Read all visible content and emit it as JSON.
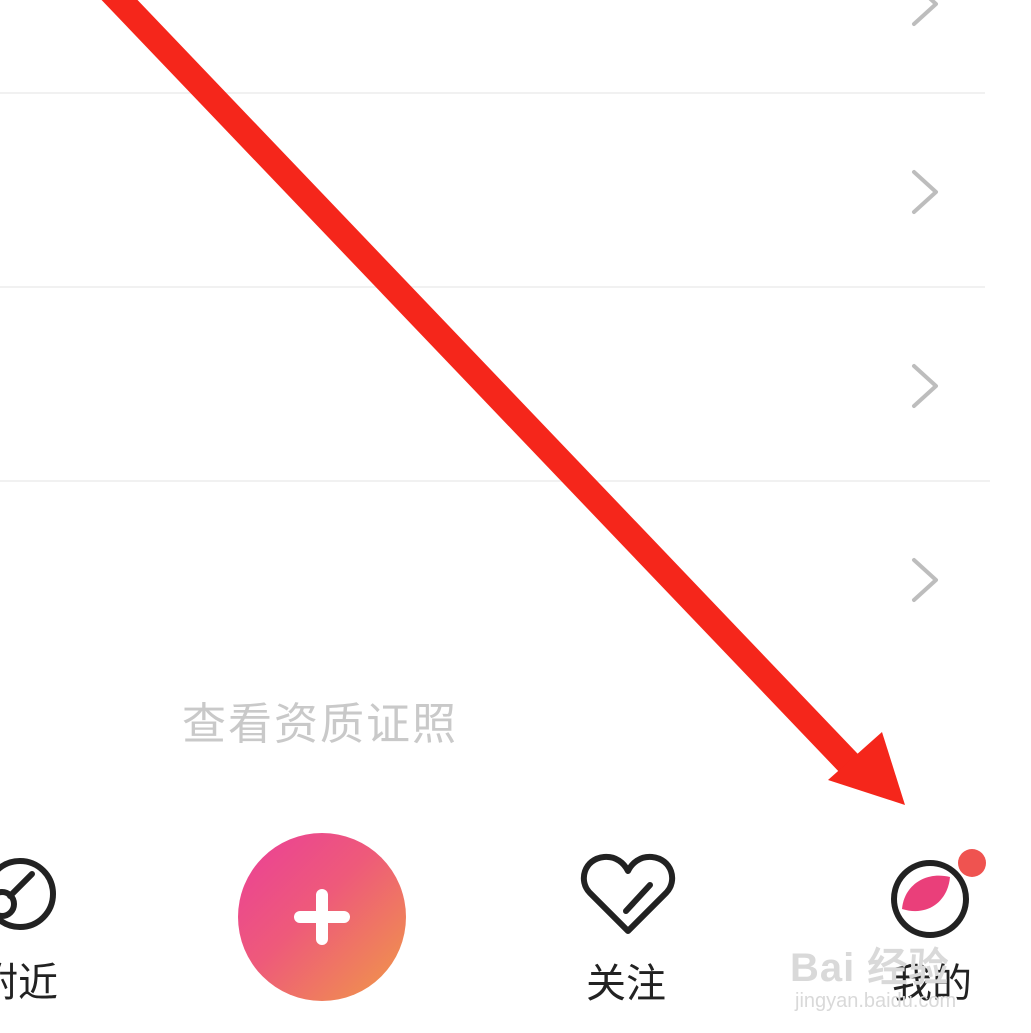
{
  "list": {
    "rows": [
      {
        "id": "row-1"
      },
      {
        "id": "row-2"
      },
      {
        "id": "row-3"
      },
      {
        "id": "row-4"
      }
    ]
  },
  "license_link": "查看资质证照",
  "tab_bar": {
    "nearby": {
      "label": "附近",
      "icon": "compass-icon"
    },
    "publish": {
      "icon": "plus-icon"
    },
    "follow": {
      "label": "关注",
      "icon": "heart-icon"
    },
    "mine": {
      "label": "我的",
      "icon": "profile-icon",
      "has_badge": true
    }
  },
  "annotation": {
    "type": "arrow",
    "color": "#f5261b",
    "target": "mine-tab"
  },
  "watermark": {
    "logo": "Bai 经验",
    "url": "jingyan.baidu.com"
  },
  "colors": {
    "accent_gradient": [
      "#ea3f98",
      "#f09a46"
    ],
    "badge": "#ef5350",
    "muted_text": "#c9c9c9"
  }
}
